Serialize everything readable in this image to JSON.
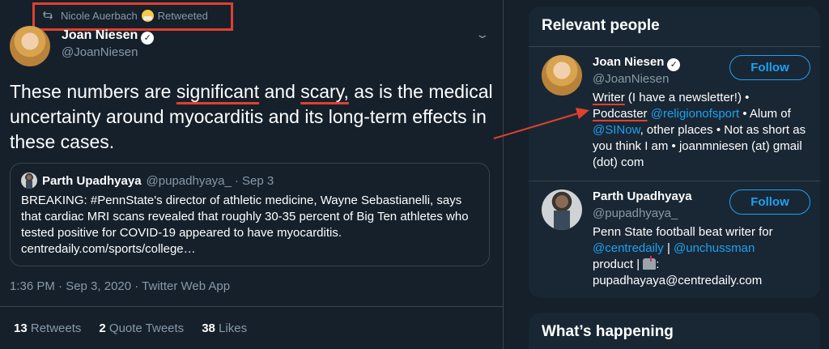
{
  "retweet": {
    "by": "Nicole Auerbach",
    "label": "Retweeted"
  },
  "tweet": {
    "author_name": "Joan Niesen",
    "author_handle": "@JoanNiesen",
    "text_parts": [
      "These numbers are ",
      "significant",
      " and ",
      "scary,",
      " as is the medical uncertainty around myocarditis and its long-term effects in these cases."
    ],
    "timestamp": "1:36 PM · Sep 3, 2020 · Twitter Web App",
    "stats": [
      {
        "count": "13",
        "label": "Retweets"
      },
      {
        "count": "2",
        "label": "Quote Tweets"
      },
      {
        "count": "38",
        "label": "Likes"
      }
    ]
  },
  "quote": {
    "author_name": "Parth Upadhyaya",
    "author_handle": "@pupadhyaya_",
    "date": "· Sep 3",
    "text": "BREAKING: #PennState's director of athletic medicine, Wayne Sebastianelli, says that cardiac MRI scans revealed that roughly 30-35 percent of Big Ten athletes who tested positive for COVID-19 appeared to have myocarditis. centredaily.com/sports/college…"
  },
  "relevant_people": {
    "title": "Relevant people",
    "follow_label": "Follow",
    "people": [
      {
        "name": "Joan Niesen",
        "handle": "@JoanNiesen",
        "bio": {
          "writer": "Writer",
          "after_writer": " (I have a newsletter!) •",
          "podcaster": "Podcaster",
          "mention1": "@religionofsport",
          "after_mention1": " • Alum of",
          "mention2": "@SINow",
          "rest": ", other places • Not as short as you think I am • joanmniesen (at) gmail (dot) com"
        }
      },
      {
        "name": "Parth Upadhyaya",
        "handle": "@pupadhyaya_",
        "bio": {
          "prefix": "Penn State football beat writer for",
          "mention1": "@centredaily",
          "sep": " | ",
          "mention2": "@unchussman",
          "middle": "product | ",
          "suffix": ":",
          "email": "pupadhayaya@centredaily.com"
        }
      }
    ]
  },
  "whats_happening": {
    "title": "What’s happening"
  },
  "colors": {
    "background": "#15202b",
    "card": "#192734",
    "accent": "#1da1f2",
    "annotation": "#e0402f",
    "muted": "#8899a6"
  },
  "icons": [
    "retweet-icon",
    "verified-badge-icon",
    "chevron-down-icon",
    "mailbox-icon",
    "annotation-arrow"
  ]
}
